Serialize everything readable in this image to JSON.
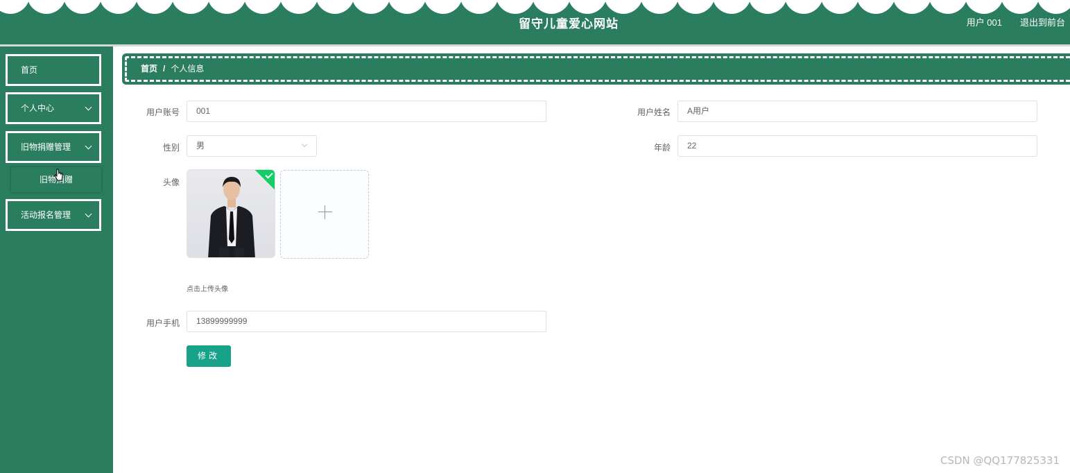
{
  "header": {
    "title": "留守儿童爱心网站",
    "user": "用户 001",
    "exit_label": "退出到前台"
  },
  "sidebar": {
    "items": [
      {
        "label": "首页"
      },
      {
        "label": "个人中心"
      },
      {
        "label": "旧物捐赠管理"
      },
      {
        "label": "活动报名管理"
      }
    ],
    "submenu": {
      "label": "旧物捐赠"
    }
  },
  "breadcrumb": {
    "home": "首页",
    "separator": "/",
    "current": "个人信息"
  },
  "form": {
    "account_label": "用户账号",
    "account_value": "001",
    "name_label": "用户姓名",
    "name_value": "A用户",
    "gender_label": "性别",
    "gender_value": "男",
    "age_label": "年龄",
    "age_value": "22",
    "avatar_label": "头像",
    "avatar_tip": "点击上传头像",
    "phone_label": "用户手机",
    "phone_value": "13899999999",
    "submit_label": "修改"
  },
  "watermark": "CSDN @QQ177825331",
  "colors": {
    "primary_green": "#2a7d5f",
    "button_teal": "#17a38a",
    "success_check": "#13ce66"
  }
}
